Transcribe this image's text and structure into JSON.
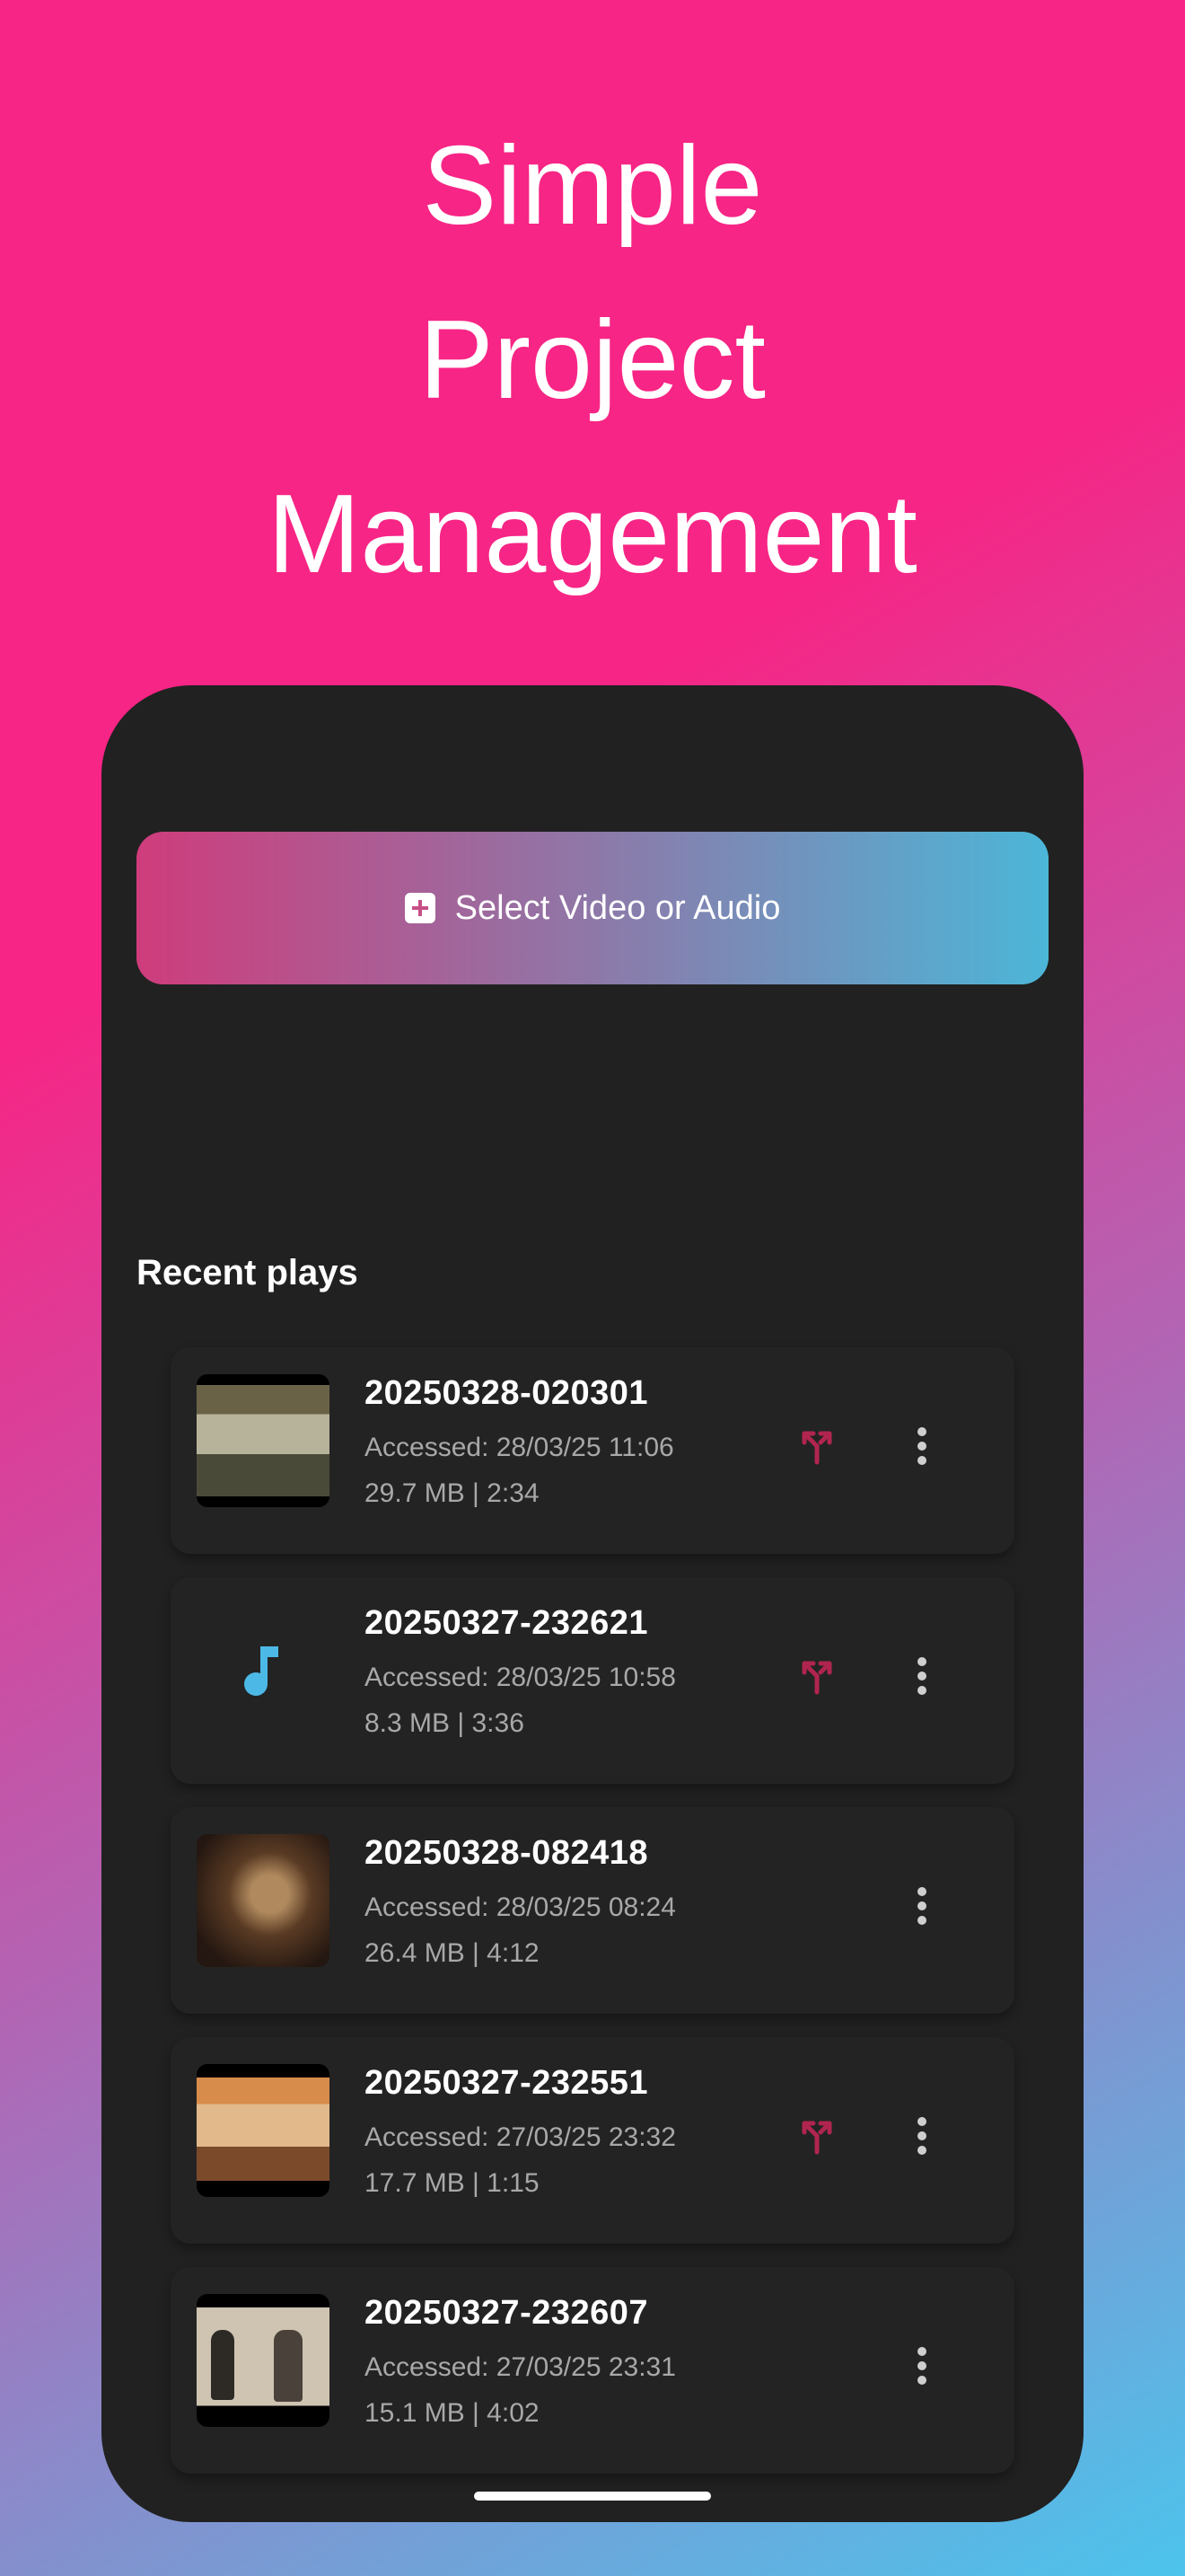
{
  "headline": [
    "Simple",
    "Project",
    "Management"
  ],
  "select_button": {
    "label": "Select Video or Audio",
    "icon": "plus-square-icon"
  },
  "recent": {
    "title": "Recent plays",
    "items": [
      {
        "name": "20250328-020301",
        "accessed": "Accessed: 28/03/25 11:06",
        "info": "29.7 MB  |  2:34",
        "kind": "video",
        "split": true
      },
      {
        "name": "20250327-232621",
        "accessed": "Accessed: 28/03/25 10:58",
        "info": "8.3 MB  |  3:36",
        "kind": "audio",
        "split": true
      },
      {
        "name": "20250328-082418",
        "accessed": "Accessed: 28/03/25 08:24",
        "info": "26.4 MB  |  4:12",
        "kind": "video",
        "split": false
      },
      {
        "name": "20250327-232551",
        "accessed": "Accessed: 27/03/25 23:32",
        "info": "17.7 MB  |  1:15",
        "kind": "video",
        "split": true
      },
      {
        "name": "20250327-232607",
        "accessed": "Accessed: 27/03/25 23:31",
        "info": "15.1 MB  |  4:02",
        "kind": "video",
        "split": false
      }
    ]
  },
  "colors": {
    "split_icon": "#b0254f",
    "music_icon": "#4cb8e6",
    "card_bg": "#232323"
  }
}
